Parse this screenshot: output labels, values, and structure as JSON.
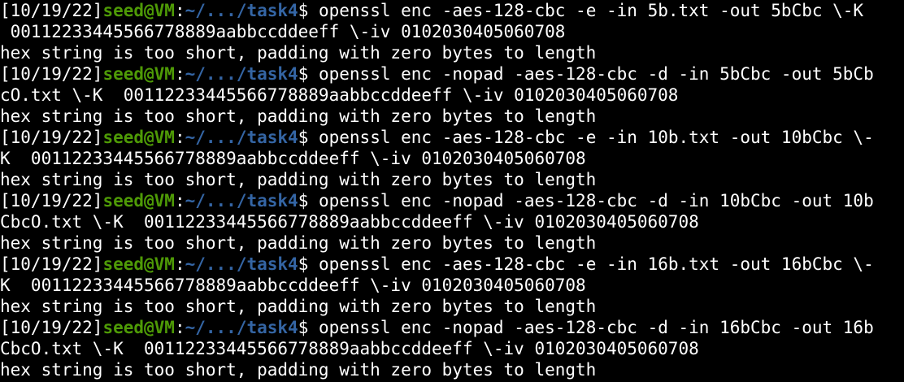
{
  "terminal": {
    "prompt": {
      "timestamp": "[10/19/22]",
      "userhost": "seed@VM",
      "colon": ":",
      "path_prefix": "~/.../",
      "path_dir": "task4",
      "dollar": "$ "
    },
    "colors": {
      "background": "#000000",
      "text": "#ffffff",
      "userhost": "#4e9a06",
      "path": "#3465a4"
    },
    "blocks": [
      {
        "cmd_line1": "openssl enc -aes-128-cbc -e -in 5b.txt -out 5bCbc \\-K ",
        "cmd_line2": " 00112233445566778889aabbccddeeff \\-iv 0102030405060708",
        "output": "hex string is too short, padding with zero bytes to length"
      },
      {
        "cmd_line1": "openssl enc -nopad -aes-128-cbc -d -in 5bCbc -out 5bCb",
        "cmd_line2": "cO.txt \\-K  00112233445566778889aabbccddeeff \\-iv 0102030405060708",
        "output": "hex string is too short, padding with zero bytes to length"
      },
      {
        "cmd_line1": "openssl enc -aes-128-cbc -e -in 10b.txt -out 10bCbc \\-",
        "cmd_line2": "K  00112233445566778889aabbccddeeff \\-iv 0102030405060708",
        "output": "hex string is too short, padding with zero bytes to length"
      },
      {
        "cmd_line1": "openssl enc -nopad -aes-128-cbc -d -in 10bCbc -out 10b",
        "cmd_line2": "CbcO.txt \\-K  00112233445566778889aabbccddeeff \\-iv 0102030405060708",
        "output": "hex string is too short, padding with zero bytes to length"
      },
      {
        "cmd_line1": "openssl enc -aes-128-cbc -e -in 16b.txt -out 16bCbc \\-",
        "cmd_line2": "K  00112233445566778889aabbccddeeff \\-iv 0102030405060708",
        "output": "hex string is too short, padding with zero bytes to length"
      },
      {
        "cmd_line1": "openssl enc -nopad -aes-128-cbc -d -in 16bCbc -out 16b",
        "cmd_line2": "CbcO.txt \\-K  00112233445566778889aabbccddeeff \\-iv 0102030405060708",
        "output": "hex string is too short, padding with zero bytes to length"
      }
    ]
  }
}
